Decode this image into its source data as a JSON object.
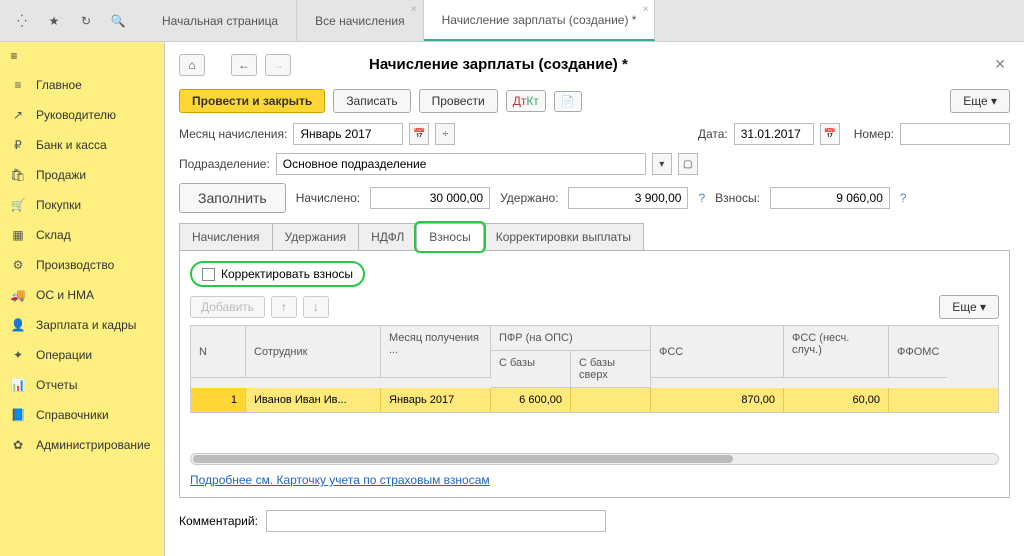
{
  "topTabs": [
    {
      "label": "Начальная страница"
    },
    {
      "label": "Все начисления"
    },
    {
      "label": "Начисление зарплаты (создание) *",
      "active": true
    }
  ],
  "sidebar": {
    "items": [
      {
        "label": "Главное",
        "icon": "≡"
      },
      {
        "label": "Руководителю",
        "icon": "↗"
      },
      {
        "label": "Банк и касса",
        "icon": "₽"
      },
      {
        "label": "Продажи",
        "icon": "🛍"
      },
      {
        "label": "Покупки",
        "icon": "🛒"
      },
      {
        "label": "Склад",
        "icon": "▦"
      },
      {
        "label": "Производство",
        "icon": "⚙"
      },
      {
        "label": "ОС и НМА",
        "icon": "🚚"
      },
      {
        "label": "Зарплата и кадры",
        "icon": "👤"
      },
      {
        "label": "Операции",
        "icon": "✦"
      },
      {
        "label": "Отчеты",
        "icon": "📊"
      },
      {
        "label": "Справочники",
        "icon": "📘"
      },
      {
        "label": "Администрирование",
        "icon": "✿"
      }
    ]
  },
  "page": {
    "title": "Начисление зарплаты (создание) *",
    "btnPostClose": "Провести и закрыть",
    "btnWrite": "Записать",
    "btnPost": "Провести",
    "btnMore": "Еще ▾",
    "lblMonth": "Месяц начисления:",
    "month": "Январь 2017",
    "lblDate": "Дата:",
    "date": "31.01.2017",
    "lblNumber": "Номер:",
    "number": "",
    "lblDept": "Подразделение:",
    "dept": "Основное подразделение",
    "btnFill": "Заполнить",
    "lblAccrued": "Начислено:",
    "accrued": "30 000,00",
    "lblHeld": "Удержано:",
    "held": "3 900,00",
    "lblContrib": "Взносы:",
    "contrib": "9 060,00"
  },
  "innerTabs": [
    {
      "label": "Начисления"
    },
    {
      "label": "Удержания"
    },
    {
      "label": "НДФЛ"
    },
    {
      "label": "Взносы",
      "active": true,
      "highlight": true
    },
    {
      "label": "Корректировки выплаты"
    }
  ],
  "panel": {
    "chkLabel": "Корректировать взносы",
    "btnAdd": "Добавить",
    "btnMore": "Еще ▾",
    "headers": {
      "n": "N",
      "emp": "Сотрудник",
      "month": "Месяц получения ...",
      "pfr": "ПФР (на ОПС)",
      "pfrBase": "С базы",
      "pfrOver": "С базы сверх",
      "fss": "ФСС",
      "fssNs": "ФСС (несч. случ.)",
      "ffoms": "ФФОМС"
    },
    "row": {
      "n": "1",
      "emp": "Иванов Иван Ив...",
      "month": "Январь 2017",
      "pfrBase": "6 600,00",
      "pfrOver": "",
      "fss": "870,00",
      "fssNs": "60,00",
      "ffoms": ""
    },
    "link": "Подробнее см. Карточку учета по страховым взносам"
  },
  "commentLabel": "Комментарий:"
}
